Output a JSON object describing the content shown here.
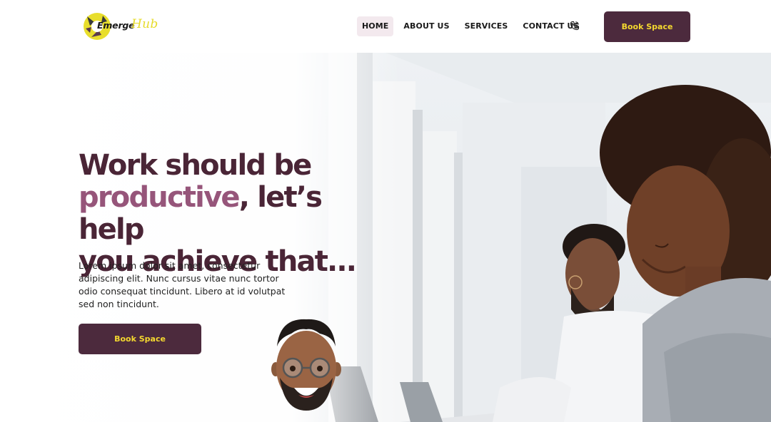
{
  "logo": {
    "word": "Emerge",
    "script": "Hub"
  },
  "nav": {
    "items": [
      {
        "label": "HOME",
        "active": true
      },
      {
        "label": "ABOUT US",
        "active": false
      },
      {
        "label": "SERVICES",
        "active": false
      },
      {
        "label": "CONTACT US",
        "active": false
      }
    ],
    "phone_icon": "phone-icon",
    "cta_label": "Book Space"
  },
  "hero": {
    "headline_line1": "Work should be",
    "headline_accent": "productive",
    "headline_line2_rest": ", let’s help",
    "headline_line3": "you achieve that...",
    "body": "Lorem ipsum dolor sit amet, consectetur adipiscing elit. Nunc cursus vitae nunc tortor odio consequat tincidunt. Libero at id volutpat sed non tincidunt.",
    "cta_label": "Book Space"
  },
  "colors": {
    "primary": "#4c2a3d",
    "accent_text": "#96557a",
    "button_text": "#f4d82f",
    "nav_active_bg": "#f3e9ee",
    "logo_yellow": "#e6db2a"
  }
}
